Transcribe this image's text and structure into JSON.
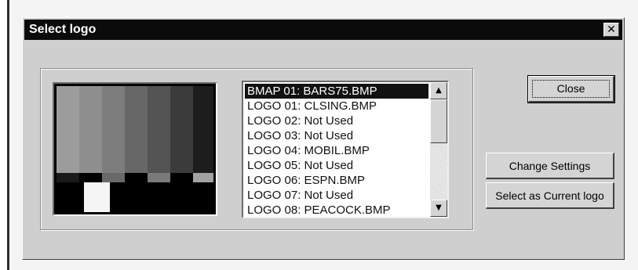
{
  "window": {
    "title": "Select logo",
    "close_glyph": "✕"
  },
  "logo_list": {
    "items": [
      {
        "label": "BMAP 01:  BARS75.BMP",
        "selected": true
      },
      {
        "label": "LOGO 01:  CLSING.BMP",
        "selected": false
      },
      {
        "label": "LOGO 02:  Not Used",
        "selected": false
      },
      {
        "label": "LOGO 03:  Not Used",
        "selected": false
      },
      {
        "label": "LOGO 04:  MOBIL.BMP",
        "selected": false
      },
      {
        "label": "LOGO 05:  Not Used",
        "selected": false
      },
      {
        "label": "LOGO 06:  ESPN.BMP",
        "selected": false
      },
      {
        "label": "LOGO 07:  Not Used",
        "selected": false
      },
      {
        "label": "LOGO 08:  PEACOCK.BMP",
        "selected": false
      }
    ],
    "scroll_up_icon": "▲",
    "scroll_down_icon": "▼"
  },
  "buttons": {
    "close_label": "Close",
    "change_settings_label": "Change Settings",
    "select_current_label": "Select as Current logo"
  },
  "preview": {
    "bar_colors": [
      "#9c9c9c",
      "#8e8e8e",
      "#7d7d7d",
      "#676767",
      "#545454",
      "#3b3b3b",
      "#1d1d1d"
    ],
    "subbar_colors": [
      "#1a1a1a",
      "#000000",
      "#6a6a6a",
      "#000000",
      "#7a7a7a",
      "#000000",
      "#a2a2a2"
    ]
  },
  "colors": {
    "titlebar": "#0b0b0b",
    "dialog_face": "#cfcfcf",
    "selection": "#111111"
  }
}
